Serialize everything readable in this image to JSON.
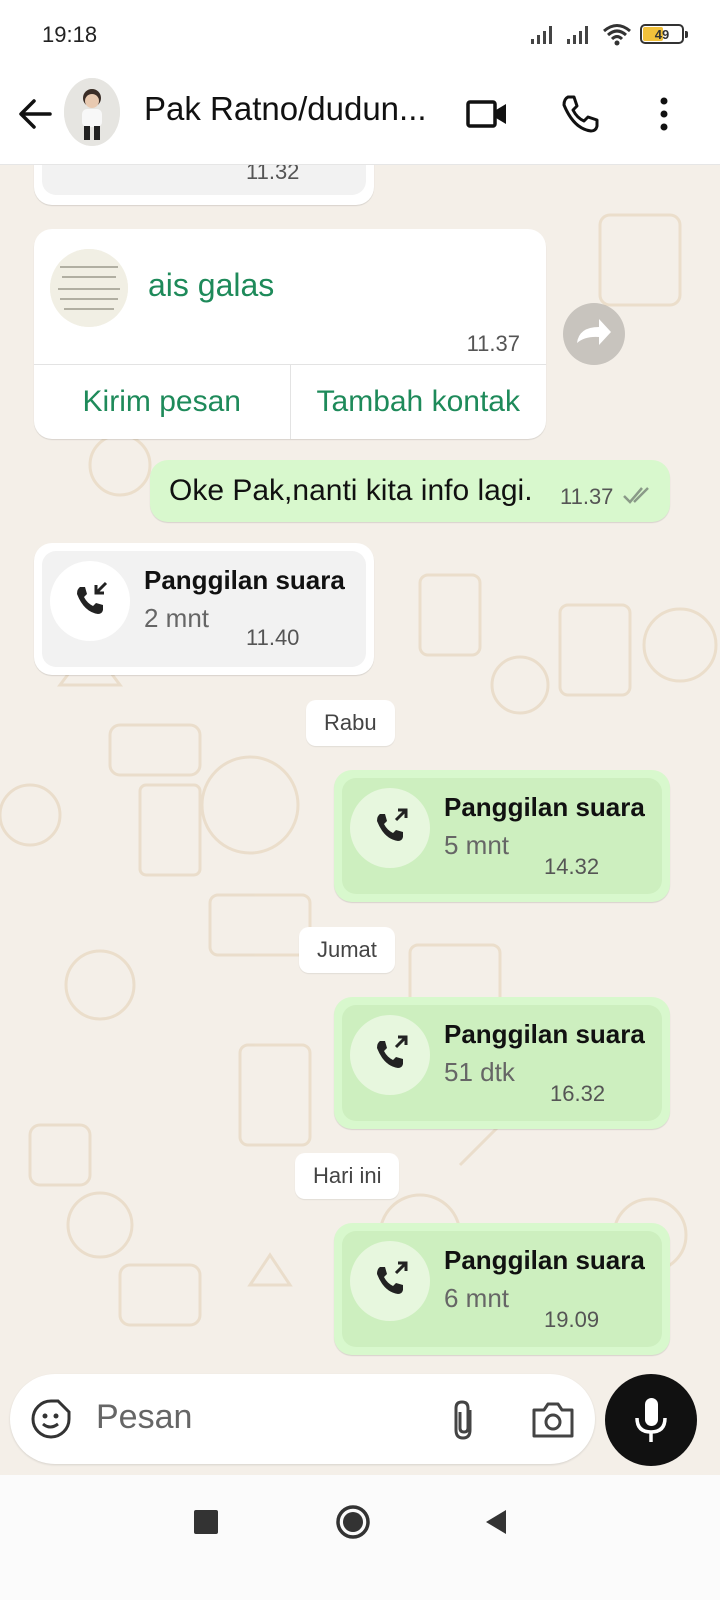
{
  "status_bar": {
    "time": "19:18",
    "battery": "49"
  },
  "header": {
    "contact_name": "Pak Ratno/dudun..."
  },
  "messages": {
    "top_partial_time": "11.32",
    "contact_card": {
      "name": "ais galas",
      "time": "11.37",
      "send_message": "Kirim pesan",
      "add_contact": "Tambah kontak"
    },
    "text_out": {
      "text": "Oke Pak,nanti kita info lagi.",
      "time": "11.37"
    },
    "call_in": {
      "title": "Panggilan suara",
      "duration": "2 mnt",
      "time": "11.40"
    },
    "day_1": "Rabu",
    "call_out_1": {
      "title": "Panggilan suara",
      "duration": "5 mnt",
      "time": "14.32"
    },
    "day_2": "Jumat",
    "call_out_2": {
      "title": "Panggilan suara",
      "duration": "51 dtk",
      "time": "16.32"
    },
    "day_3": "Hari ini",
    "call_out_3": {
      "title": "Panggilan suara",
      "duration": "6 mnt",
      "time": "19.09"
    }
  },
  "input": {
    "placeholder": "Pesan"
  },
  "colors": {
    "accent_green": "#1e8a5a",
    "outgoing_bubble": "#d8f8cd",
    "chat_background": "#f4efe8",
    "read_tick": "#53bdeb"
  }
}
